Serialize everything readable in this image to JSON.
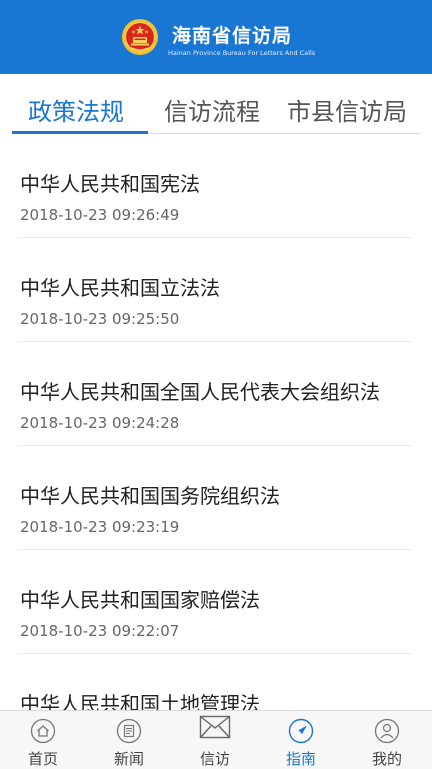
{
  "header": {
    "title": "海南省信访局",
    "subtitle": "Hainan Province Bureau For Letters And Calls",
    "brand_color": "#1976d2"
  },
  "tabs": [
    {
      "label": "政策法规",
      "active": true
    },
    {
      "label": "信访流程",
      "active": false
    },
    {
      "label": "市县信访局",
      "active": false
    }
  ],
  "list": [
    {
      "title": "中华人民共和国宪法",
      "date": "2018-10-23 09:26:49"
    },
    {
      "title": "中华人民共和国立法法",
      "date": "2018-10-23 09:25:50"
    },
    {
      "title": "中华人民共和国全国人民代表大会组织法",
      "date": "2018-10-23 09:24:28"
    },
    {
      "title": "中华人民共和国国务院组织法",
      "date": "2018-10-23 09:23:19"
    },
    {
      "title": "中华人民共和国国家赔偿法",
      "date": "2018-10-23 09:22:07"
    },
    {
      "title": "中华人民共和国土地管理法",
      "date": ""
    }
  ],
  "bottom_nav": [
    {
      "label": "首页",
      "icon": "home-icon",
      "active": false
    },
    {
      "label": "新闻",
      "icon": "news-icon",
      "active": false
    },
    {
      "label": "信访",
      "icon": "mail-icon",
      "active": false
    },
    {
      "label": "指南",
      "icon": "compass-icon",
      "active": true
    },
    {
      "label": "我的",
      "icon": "user-icon",
      "active": false
    }
  ]
}
